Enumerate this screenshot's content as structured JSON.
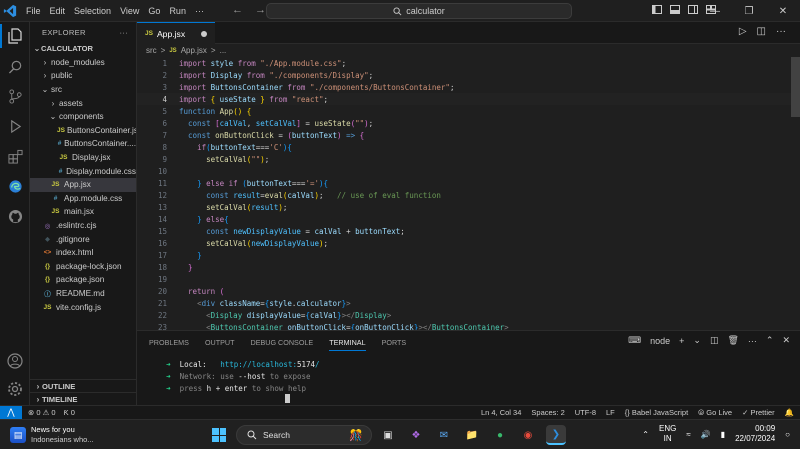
{
  "titlebar": {
    "menu": [
      "File",
      "Edit",
      "Selection",
      "View",
      "Go",
      "Run",
      "···"
    ],
    "search_text": "calculator"
  },
  "sidebar": {
    "header": "EXPLORER",
    "root": "CALCULATOR",
    "items": [
      {
        "label": "node_modules",
        "kind": "folder",
        "depth": 1,
        "chevron": ">"
      },
      {
        "label": "public",
        "kind": "folder",
        "depth": 1,
        "chevron": ">"
      },
      {
        "label": "src",
        "kind": "folder",
        "depth": 1,
        "chevron": "v"
      },
      {
        "label": "assets",
        "kind": "folder",
        "depth": 2,
        "chevron": ">"
      },
      {
        "label": "components",
        "kind": "folder",
        "depth": 2,
        "chevron": "v"
      },
      {
        "label": "ButtonsContainer.jsx",
        "kind": "js",
        "depth": 3,
        "icon": "JS"
      },
      {
        "label": "ButtonsContainer....",
        "kind": "css",
        "depth": 3,
        "icon": "#"
      },
      {
        "label": "Display.jsx",
        "kind": "js",
        "depth": 3,
        "icon": "JS"
      },
      {
        "label": "Display.module.css",
        "kind": "css",
        "depth": 3,
        "icon": "#"
      },
      {
        "label": "App.jsx",
        "kind": "js",
        "depth": 2,
        "icon": "JS",
        "selected": true
      },
      {
        "label": "App.module.css",
        "kind": "css",
        "depth": 2,
        "icon": "#"
      },
      {
        "label": "main.jsx",
        "kind": "js",
        "depth": 2,
        "icon": "JS"
      },
      {
        "label": ".eslintrc.cjs",
        "kind": "eslint",
        "depth": 1,
        "icon": "◎"
      },
      {
        "label": ".gitignore",
        "kind": "git",
        "depth": 1,
        "icon": "◆"
      },
      {
        "label": "index.html",
        "kind": "html",
        "depth": 1,
        "icon": "<>"
      },
      {
        "label": "package-lock.json",
        "kind": "json",
        "depth": 1,
        "icon": "{}"
      },
      {
        "label": "package.json",
        "kind": "json",
        "depth": 1,
        "icon": "{}"
      },
      {
        "label": "README.md",
        "kind": "md",
        "depth": 1,
        "icon": "ⓘ"
      },
      {
        "label": "vite.config.js",
        "kind": "js",
        "depth": 1,
        "icon": "JS"
      }
    ],
    "outline": "OUTLINE",
    "timeline": "TIMELINE"
  },
  "editor": {
    "tab_label": "App.jsx",
    "tab_icon": "JS",
    "breadcrumb": [
      "src",
      ">",
      "JS",
      "App.jsx",
      ">",
      "..."
    ],
    "current_line": 4,
    "lines": [
      [
        [
          "k",
          "import "
        ],
        [
          "v",
          "style"
        ],
        [
          "k",
          " from "
        ],
        [
          "s",
          "\"./App.module.css\""
        ],
        [
          "p",
          ";"
        ]
      ],
      [
        [
          "k",
          "import "
        ],
        [
          "v",
          "Display"
        ],
        [
          "k",
          " from "
        ],
        [
          "s",
          "\"./components/Display\""
        ],
        [
          "p",
          ";"
        ]
      ],
      [
        [
          "k",
          "import "
        ],
        [
          "v",
          "ButtonsContainer"
        ],
        [
          "k",
          " from "
        ],
        [
          "s",
          "\"./components/ButtonsContainer\""
        ],
        [
          "p",
          ";"
        ]
      ],
      [
        [
          "k",
          "import "
        ],
        [
          "y",
          "{ "
        ],
        [
          "v",
          "useState"
        ],
        [
          "y",
          " }"
        ],
        [
          "k",
          " from "
        ],
        [
          "s",
          "\"react\""
        ],
        [
          "p",
          ";"
        ]
      ],
      [
        [
          "kb",
          "function "
        ],
        [
          "f",
          "App"
        ],
        [
          "y",
          "() {"
        ]
      ],
      [
        [
          "p",
          "  "
        ],
        [
          "kb",
          "const "
        ],
        [
          "pk",
          "["
        ],
        [
          "c",
          "calVal"
        ],
        [
          "p",
          ", "
        ],
        [
          "c",
          "setCalVal"
        ],
        [
          "pk",
          "]"
        ],
        [
          "p",
          " = "
        ],
        [
          "f",
          "useState"
        ],
        [
          "pk",
          "("
        ],
        [
          "s",
          "\"\""
        ],
        [
          "pk",
          ")"
        ],
        [
          "p",
          ";"
        ]
      ],
      [
        [
          "p",
          "  "
        ],
        [
          "kb",
          "const "
        ],
        [
          "f",
          "onButtonClick"
        ],
        [
          "p",
          " = "
        ],
        [
          "pk",
          "("
        ],
        [
          "v",
          "buttonText"
        ],
        [
          "pk",
          ")"
        ],
        [
          "kb",
          " =>"
        ],
        [
          "pk",
          " {"
        ]
      ],
      [
        [
          "p",
          "    "
        ],
        [
          "k",
          "if"
        ],
        [
          "bl",
          "("
        ],
        [
          "v",
          "buttonText"
        ],
        [
          "p",
          "==="
        ],
        [
          "s",
          "'C'"
        ],
        [
          "bl",
          ")"
        ],
        [
          "bl",
          "{"
        ]
      ],
      [
        [
          "p",
          "      "
        ],
        [
          "f",
          "setCalVal"
        ],
        [
          "y",
          "("
        ],
        [
          "s",
          "\"\""
        ],
        [
          "y",
          ")"
        ],
        [
          "p",
          ";"
        ]
      ],
      [],
      [
        [
          "p",
          "    "
        ],
        [
          "bl",
          "}"
        ],
        [
          "k",
          " else if "
        ],
        [
          "bl",
          "("
        ],
        [
          "v",
          "buttonText"
        ],
        [
          "p",
          "==="
        ],
        [
          "s",
          "'='"
        ],
        [
          "bl",
          ")"
        ],
        [
          "bl",
          "{"
        ]
      ],
      [
        [
          "p",
          "      "
        ],
        [
          "kb",
          "const "
        ],
        [
          "c",
          "result"
        ],
        [
          "p",
          "="
        ],
        [
          "f",
          "eval"
        ],
        [
          "y",
          "("
        ],
        [
          "v",
          "calVal"
        ],
        [
          "y",
          ")"
        ],
        [
          "p",
          ";   "
        ],
        [
          "cm",
          "// use of eval function"
        ]
      ],
      [
        [
          "p",
          "      "
        ],
        [
          "f",
          "setCalVal"
        ],
        [
          "y",
          "("
        ],
        [
          "c",
          "result"
        ],
        [
          "y",
          ")"
        ],
        [
          "p",
          ";"
        ]
      ],
      [
        [
          "p",
          "    "
        ],
        [
          "bl",
          "}"
        ],
        [
          "k",
          " else"
        ],
        [
          "bl",
          "{"
        ]
      ],
      [
        [
          "p",
          "      "
        ],
        [
          "kb",
          "const "
        ],
        [
          "c",
          "newDisplayValue"
        ],
        [
          "p",
          " = "
        ],
        [
          "v",
          "calVal"
        ],
        [
          "p",
          " + "
        ],
        [
          "v",
          "buttonText"
        ],
        [
          "p",
          ";"
        ]
      ],
      [
        [
          "p",
          "      "
        ],
        [
          "f",
          "setCalVal"
        ],
        [
          "y",
          "("
        ],
        [
          "c",
          "newDisplayValue"
        ],
        [
          "y",
          ")"
        ],
        [
          "p",
          ";"
        ]
      ],
      [
        [
          "p",
          "    "
        ],
        [
          "bl",
          "}"
        ]
      ],
      [
        [
          "p",
          "  "
        ],
        [
          "pk",
          "}"
        ]
      ],
      [],
      [
        [
          "p",
          "  "
        ],
        [
          "k",
          "return "
        ],
        [
          "pk",
          "("
        ]
      ],
      [
        [
          "p",
          "    "
        ],
        [
          "gr",
          "<"
        ],
        [
          "tg",
          "div "
        ],
        [
          "v",
          "className"
        ],
        [
          "p",
          "="
        ],
        [
          "bl",
          "{"
        ],
        [
          "v",
          "style"
        ],
        [
          "p",
          "."
        ],
        [
          "v",
          "calculator"
        ],
        [
          "bl",
          "}"
        ],
        [
          "gr",
          ">"
        ]
      ],
      [
        [
          "p",
          "      "
        ],
        [
          "gr",
          "<"
        ],
        [
          "t",
          "Display "
        ],
        [
          "v",
          "displayValue"
        ],
        [
          "p",
          "="
        ],
        [
          "bl",
          "{"
        ],
        [
          "v",
          "calVal"
        ],
        [
          "bl",
          "}"
        ],
        [
          "gr",
          "></"
        ],
        [
          "t",
          "Display"
        ],
        [
          "gr",
          ">"
        ]
      ],
      [
        [
          "p",
          "      "
        ],
        [
          "gr",
          "<"
        ],
        [
          "t",
          "ButtonsContainer "
        ],
        [
          "v",
          "onButtonClick"
        ],
        [
          "p",
          "="
        ],
        [
          "bl",
          "{"
        ],
        [
          "v",
          "onButtonClick"
        ],
        [
          "bl",
          "}"
        ],
        [
          "gr",
          "></"
        ],
        [
          "t",
          "ButtonsContainer"
        ],
        [
          "gr",
          ">"
        ]
      ]
    ]
  },
  "panel": {
    "tabs": [
      "PROBLEMS",
      "OUTPUT",
      "DEBUG CONSOLE",
      "TERMINAL",
      "PORTS"
    ],
    "active_tab": "TERMINAL",
    "terminal_name": "node",
    "terminal_lines": [
      [
        [
          "tg-green",
          "  ➜  "
        ],
        [
          "tw",
          "Local:   "
        ],
        [
          "tg-cyan",
          "http://localhost:"
        ],
        [
          "tw",
          "5174"
        ],
        [
          "tg-cyan",
          "/"
        ]
      ],
      [
        [
          "tg-green",
          "  ➜  "
        ],
        [
          "tdim",
          "Network: use "
        ],
        [
          "tw",
          "--host"
        ],
        [
          "tdim",
          " to expose"
        ]
      ],
      [
        [
          "tg-green",
          "  ➜  "
        ],
        [
          "tdim",
          "press "
        ],
        [
          "tw",
          "h + enter"
        ],
        [
          "tdim",
          " to show help"
        ]
      ]
    ]
  },
  "statusbar": {
    "problems": "⊗ 0 ⚠ 0",
    "ports": "Ƙ 0",
    "cursor_pos": "Ln 4, Col 34",
    "spaces": "Spaces: 2",
    "encoding": "UTF-8",
    "eol": "LF",
    "language": "{} Babel JavaScript",
    "golive": "Go Live",
    "prettier": "✓ Prettier"
  },
  "taskbar": {
    "news_title": "News for you",
    "news_sub": "Indonesians who...",
    "search_label": "Search",
    "lang_top": "ENG",
    "lang_bottom": "IN",
    "time": "00:09",
    "date": "22/07/2024"
  },
  "colors": {
    "accent": "#0078d4",
    "editor_bg": "#1f1f1f",
    "sidebar_bg": "#181818"
  }
}
